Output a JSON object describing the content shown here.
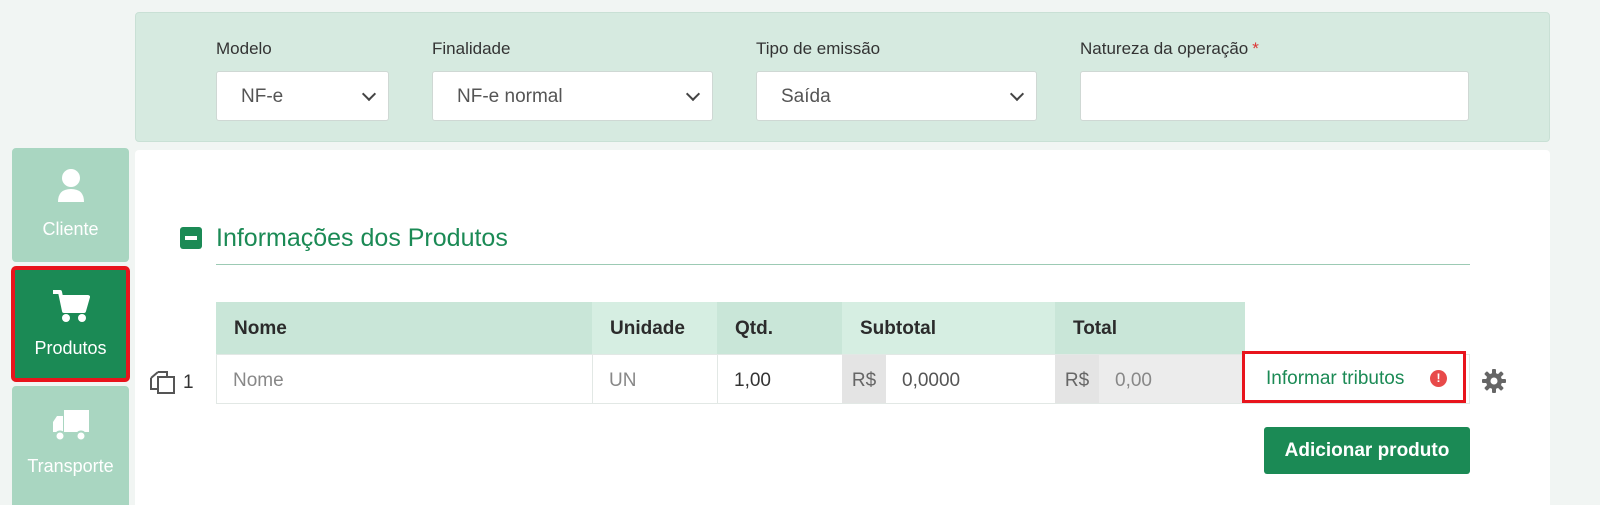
{
  "header": {
    "fields": [
      {
        "label": "Modelo",
        "value": "NF-e"
      },
      {
        "label": "Finalidade",
        "value": "NF-e normal"
      },
      {
        "label": "Tipo de emissão",
        "value": "Saída"
      },
      {
        "label": "Natureza da operação",
        "value": "",
        "required_mark": "*"
      }
    ]
  },
  "sidebar": {
    "items": [
      {
        "label": "Cliente",
        "icon": "user-icon"
      },
      {
        "label": "Produtos",
        "icon": "cart-icon",
        "active": true
      },
      {
        "label": "Transporte",
        "icon": "truck-icon"
      }
    ]
  },
  "products": {
    "title": "Informações dos Produtos",
    "columns": [
      "Nome",
      "Unidade",
      "Qtd.",
      "Subtotal",
      "Total"
    ],
    "rows": [
      {
        "number": "1",
        "nome_placeholder": "Nome",
        "unidade": "UN",
        "qtd": "1,00",
        "currency": "R$",
        "subtotal": "0,0000",
        "total": "0,00"
      }
    ],
    "tributos_link": "Informar tributos",
    "alert_mark": "!",
    "add_button": "Adicionar produto"
  },
  "colors": {
    "accent": "#1b8a55",
    "highlight": "#e8141c",
    "panel": "#d6eae0"
  }
}
